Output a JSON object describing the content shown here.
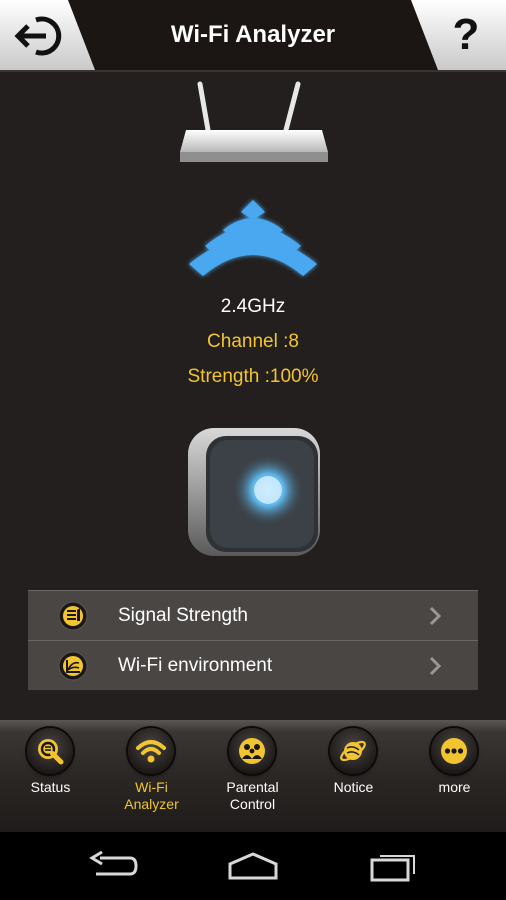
{
  "header": {
    "title": "Wi-Fi Analyzer",
    "back_icon": "exit-arrow-icon",
    "help_label": "?"
  },
  "main": {
    "band": "2.4GHz",
    "channel": "Channel :8",
    "strength": "Strength :100%",
    "router_icon": "router-icon",
    "signal_icon": "wifi-signal-icon",
    "device_icon": "range-extender-device"
  },
  "menu": {
    "items": [
      {
        "label": "Signal Strength",
        "icon": "signal-strength-icon"
      },
      {
        "label": "Wi-Fi environment",
        "icon": "wifi-environment-icon"
      }
    ]
  },
  "tabs": [
    {
      "label": "Status",
      "icon": "magnifier-icon",
      "active": false
    },
    {
      "label": "Wi-Fi\nAnalyzer",
      "icon": "wifi-icon",
      "active": true
    },
    {
      "label": "Parental\nControl",
      "icon": "family-icon",
      "active": false
    },
    {
      "label": "Notice",
      "icon": "planet-icon",
      "active": false
    },
    {
      "label": "more",
      "icon": "more-dots-icon",
      "active": false
    }
  ],
  "colors": {
    "accent_yellow": "#f2c530",
    "background": "#231f1e",
    "wifi_blue": "#4aa8f0"
  }
}
